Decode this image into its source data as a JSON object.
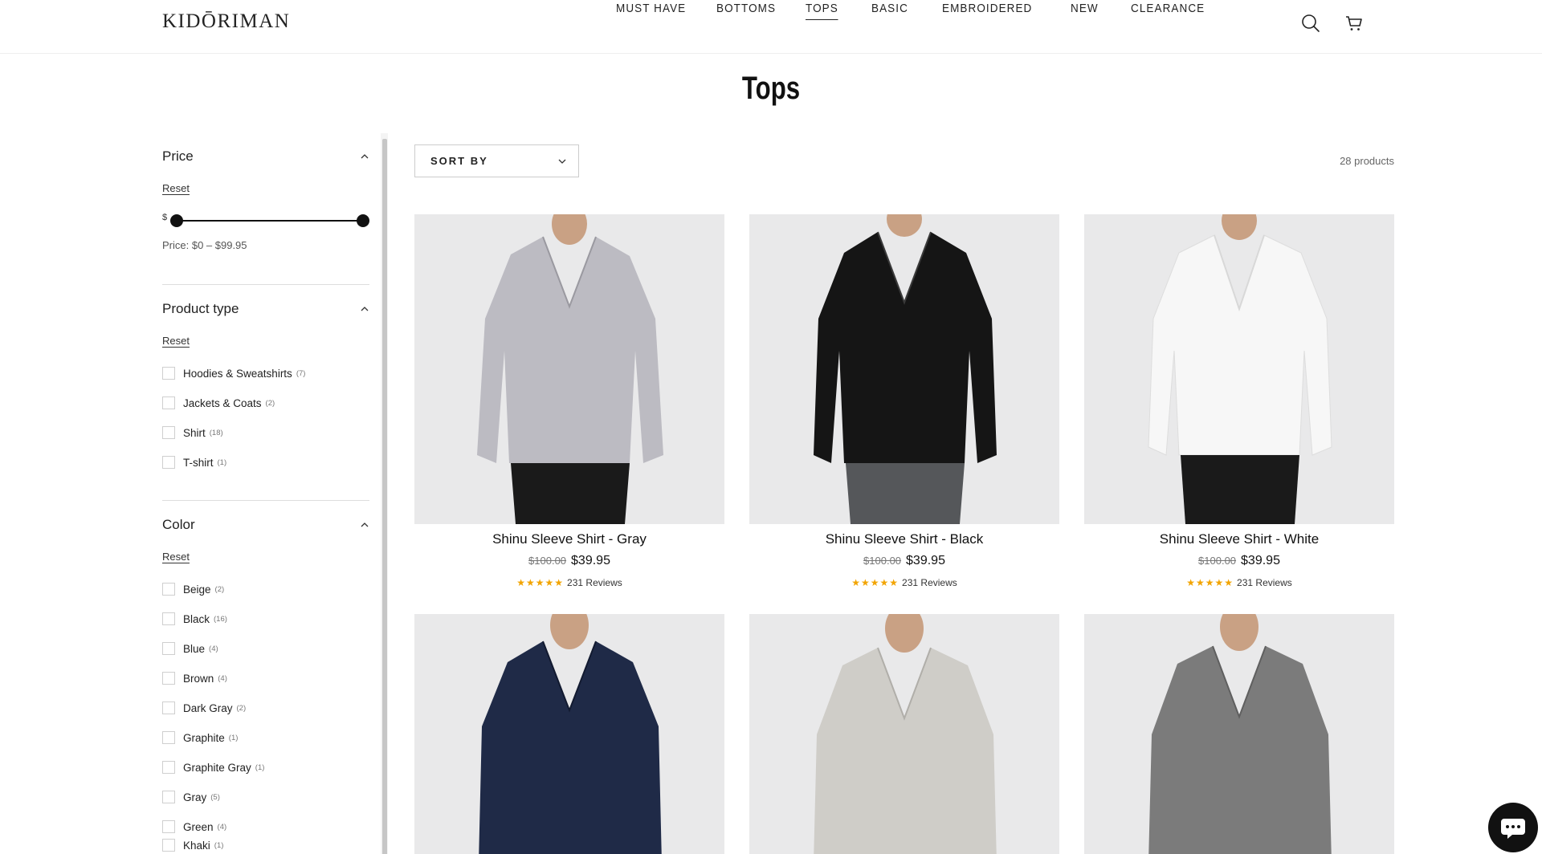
{
  "brand": {
    "logo": "KIDŌRIMAN"
  },
  "nav": {
    "items": [
      "MUST HAVE",
      "BOTTOMS",
      "TOPS",
      "BASIC",
      "EMBROIDERED",
      "NEW",
      "CLEARANCE"
    ],
    "active": "TOPS",
    "icons": [
      "search-icon",
      "cart-icon"
    ]
  },
  "page": {
    "title": "Tops"
  },
  "filters": {
    "price": {
      "title": "Price",
      "reset": "Reset",
      "currency": "$",
      "range_label": "Price: $0 – $99.95"
    },
    "product_type": {
      "title": "Product type",
      "reset": "Reset",
      "options": [
        {
          "label": "Hoodies & Sweatshirts",
          "count": "(7)"
        },
        {
          "label": "Jackets & Coats",
          "count": "(2)"
        },
        {
          "label": "Shirt",
          "count": "(18)"
        },
        {
          "label": "T-shirt",
          "count": "(1)"
        }
      ]
    },
    "color": {
      "title": "Color",
      "reset": "Reset",
      "options": [
        {
          "label": "Beige",
          "count": "(2)"
        },
        {
          "label": "Black",
          "count": "(16)"
        },
        {
          "label": "Blue",
          "count": "(4)"
        },
        {
          "label": "Brown",
          "count": "(4)"
        },
        {
          "label": "Dark Gray",
          "count": "(2)"
        },
        {
          "label": "Graphite",
          "count": "(1)"
        },
        {
          "label": "Graphite Gray",
          "count": "(1)"
        },
        {
          "label": "Gray",
          "count": "(5)"
        },
        {
          "label": "Green",
          "count": "(4)"
        },
        {
          "label": "Khaki",
          "count": "(1)"
        }
      ]
    }
  },
  "toolbar": {
    "sort_label": "SORT BY",
    "product_count": "28 products"
  },
  "products": [
    {
      "name": "Shinu Sleeve Shirt - Gray",
      "old_price": "$100.00",
      "price": "$39.95",
      "stars": "★★★★★",
      "reviews": "231 Reviews",
      "shirt_color": "#bcbbc2"
    },
    {
      "name": "Shinu Sleeve Shirt - Black",
      "old_price": "$100.00",
      "price": "$39.95",
      "stars": "★★★★★",
      "reviews": "231 Reviews",
      "shirt_color": "#151515"
    },
    {
      "name": "Shinu Sleeve Shirt - White",
      "old_price": "$100.00",
      "price": "$39.95",
      "stars": "★★★★★",
      "reviews": "231 Reviews",
      "shirt_color": "#f7f7f7"
    },
    {
      "shirt_color": "#1f2a47"
    },
    {
      "shirt_color": "#cfcdc8"
    },
    {
      "shirt_color": "#7b7b7b"
    }
  ],
  "chat": {
    "icon": "chat-icon"
  },
  "colors": {
    "accent": "#111111",
    "star": "#f2a400",
    "image_bg": "#e9e9ea"
  }
}
